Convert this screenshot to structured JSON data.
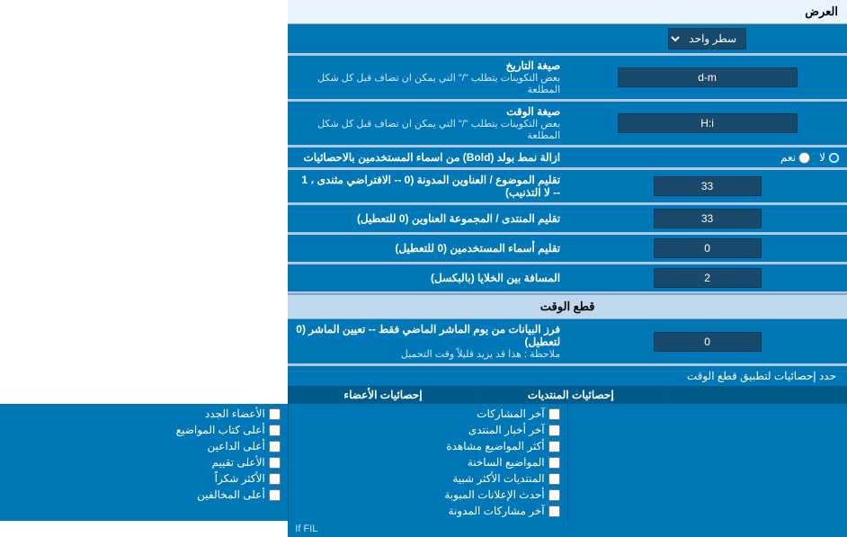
{
  "page": {
    "title": "العرض",
    "single_line_label": "سطر واحد",
    "date_format_title": "صيغة التاريخ",
    "date_format_desc": "بعض التكوينات يتطلب \"/\" التي يمكن ان تضاف قبل كل شكل المطلعة",
    "date_format_value": "d-m",
    "time_format_title": "صيغة الوقت",
    "time_format_desc": "بعض التكوينات يتطلب \"/\" التي يمكن ان تضاف قبل كل شكل المطلعة",
    "time_format_value": "H:i",
    "bold_remove_title": "ازالة نمط بولد (Bold) من اسماء المستخدمين بالاحصائيات",
    "bold_yes": "نعم",
    "bold_no": "لا",
    "bold_selected": "لا",
    "topics_title": "تقليم الموضوع / العناوين المدونة (0 -- الافتراضي مثندى ، 1 -- لا التذنيب)",
    "topics_value": "33",
    "forum_title": "تقليم المنتدى / المجموعة العناوين (0 للتعطيل)",
    "forum_value": "33",
    "users_title": "تقليم أسماء المستخدمين (0 للتعطيل)",
    "users_value": "0",
    "distance_title": "المسافة بين الخلايا (بالبكسل)",
    "distance_value": "2",
    "time_cutoff_section": "قطع الوقت",
    "time_cutoff_title": "فرز البيانات من يوم الماشر الماضي فقط -- تعيين الماشر (0 لتعطيل)",
    "time_cutoff_note": "ملاحظة : هذا قد يزيد قليلاً وقت التحميل",
    "time_cutoff_value": "0",
    "limit_label": "حدد إحصائيات لتطبيق قطع الوقت",
    "col1_header": "",
    "col2_header": "إحصائيات المنتديات",
    "col3_header": "إحصائيات الأعضاء",
    "checkboxes": {
      "col2": [
        {
          "label": "آخر المشاركات",
          "checked": false
        },
        {
          "label": "آخر أخبار المنتدى",
          "checked": false
        },
        {
          "label": "أكثر المواضيع مشاهدة",
          "checked": false
        },
        {
          "label": "المواضيع الساخنة",
          "checked": false
        },
        {
          "label": "المنتديات الأكثر شبية",
          "checked": false
        },
        {
          "label": "أحدث الإعلانات المبوبة",
          "checked": false
        },
        {
          "label": "آخر مشاركات المدونة",
          "checked": false
        }
      ],
      "col3": [
        {
          "label": "الأعضاء الجدد",
          "checked": false
        },
        {
          "label": "أعلى كتاب المواضيع",
          "checked": false
        },
        {
          "label": "أعلى الداعين",
          "checked": false
        },
        {
          "label": "الأعلى تقييم",
          "checked": false
        },
        {
          "label": "الأكثر شكراً",
          "checked": false
        },
        {
          "label": "أعلى المخالفين",
          "checked": false
        }
      ]
    }
  }
}
